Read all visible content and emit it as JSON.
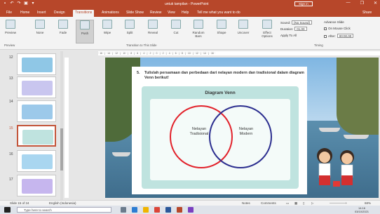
{
  "window": {
    "title": "untuk tampilan - PowerPoint",
    "sign_in": "Sign in",
    "minimize": "—",
    "restore": "❐",
    "close": "✕"
  },
  "tabs": [
    {
      "label": "File"
    },
    {
      "label": "Home"
    },
    {
      "label": "Insert"
    },
    {
      "label": "Design"
    },
    {
      "label": "Transitions"
    },
    {
      "label": "Animations"
    },
    {
      "label": "Slide Show"
    },
    {
      "label": "Review"
    },
    {
      "label": "View"
    },
    {
      "label": "Help"
    },
    {
      "label": "Tell me what you want to do"
    },
    {
      "label": "Share"
    }
  ],
  "ribbon": {
    "preview": "Preview",
    "transitions": [
      "None",
      "Fade",
      "Push",
      "Wipe",
      "Split",
      "Reveal",
      "Cut",
      "Random Bars",
      "Shape",
      "Uncover"
    ],
    "effect_options": "Effect Options",
    "group_preview": "Preview",
    "group_transitions": "Transition to This Slide",
    "group_timing": "Timing",
    "sound_label": "Sound:",
    "sound_value": "[No Sound]",
    "duration_label": "Duration:",
    "duration_value": "01,00",
    "apply_to_all": "Apply To All",
    "advance_slide": "Advance Slide",
    "on_mouse_click": "On Mouse Click",
    "after_label": "After:",
    "after_value": "00:00,00"
  },
  "ruler": "· 16 · | · 14 · | · 12 · | · 10 · | · 8 · | · 6 · | · 4 · | · 2 · | · 0 · | · 2 · | · 4 · | · 6 · | · 8 · | · 10 · | · 12 · | · 14 · | · 16 ·",
  "thumbnails": [
    {
      "num": "12",
      "color": "#8fc7e6"
    },
    {
      "num": "13",
      "color": "#c9c6ef"
    },
    {
      "num": "14",
      "color": "#9cc9ea"
    },
    {
      "num": "15",
      "color": "#bfe3df"
    },
    {
      "num": "16",
      "color": "#a9d6f0"
    },
    {
      "num": "17",
      "color": "#c6b6ee"
    }
  ],
  "slide": {
    "number": "5.",
    "instruction": "Tulislah persamaan dan perbedaan dari nelayan modern dan tradisional dalam diagram Venn berikut!",
    "venn_title": "Diagram Venn",
    "left_label_1": "Nelayan",
    "left_label_2": "Tradisional",
    "right_label_1": "Nelayan",
    "right_label_2": "Modern",
    "left_color": "#e2212a",
    "right_color": "#2b2e8f"
  },
  "status": {
    "slide_count": "Slide 15 of 24",
    "language": "English (Indonesia)",
    "notes": "Notes",
    "comments": "Comments",
    "zoom": "68%"
  },
  "taskbar": {
    "search_placeholder": "Type here to search",
    "time": "14:16",
    "date": "03/10/2021"
  }
}
